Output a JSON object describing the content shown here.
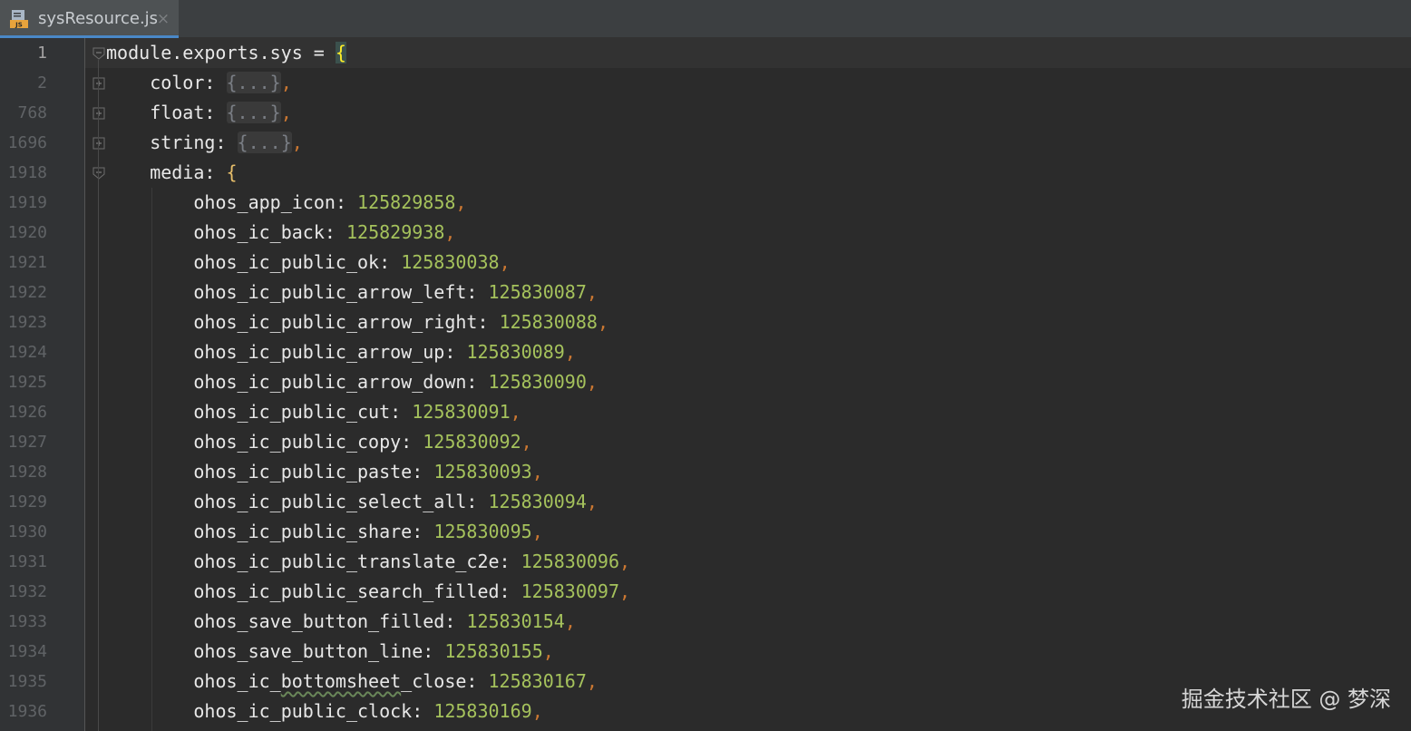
{
  "tab": {
    "title": "sysResource.js",
    "close_glyph": "×",
    "icon": "javascript-file-icon",
    "icon_badge": "JS"
  },
  "colors": {
    "background": "#2b2b2b",
    "gutter": "#313335",
    "keyword": "#e8e8e8",
    "number": "#a5c25c",
    "punctuation": "#cc7832",
    "brace": "#e8bf6a"
  },
  "lines": [
    {
      "no": "1",
      "indent": 0,
      "key": "module.exports.sys",
      "sep": " = ",
      "value": "{",
      "value_type": "brace-match",
      "trail": "",
      "fold": "open"
    },
    {
      "no": "2",
      "indent": 1,
      "key": "color",
      "sep": ": ",
      "value": "{...}",
      "value_type": "folded",
      "trail": ",",
      "fold": "plus"
    },
    {
      "no": "768",
      "indent": 1,
      "key": "float",
      "sep": ": ",
      "value": "{...}",
      "value_type": "folded",
      "trail": ",",
      "fold": "plus"
    },
    {
      "no": "1696",
      "indent": 1,
      "key": "string",
      "sep": ": ",
      "value": "{...}",
      "value_type": "folded",
      "trail": ",",
      "fold": "plus"
    },
    {
      "no": "1918",
      "indent": 1,
      "key": "media",
      "sep": ": ",
      "value": "{",
      "value_type": "brace",
      "trail": "",
      "fold": "open"
    },
    {
      "no": "1919",
      "indent": 2,
      "key": "ohos_app_icon",
      "sep": ": ",
      "value": "125829858",
      "value_type": "num",
      "trail": ","
    },
    {
      "no": "1920",
      "indent": 2,
      "key": "ohos_ic_back",
      "sep": ": ",
      "value": "125829938",
      "value_type": "num",
      "trail": ","
    },
    {
      "no": "1921",
      "indent": 2,
      "key": "ohos_ic_public_ok",
      "sep": ": ",
      "value": "125830038",
      "value_type": "num",
      "trail": ","
    },
    {
      "no": "1922",
      "indent": 2,
      "key": "ohos_ic_public_arrow_left",
      "sep": ": ",
      "value": "125830087",
      "value_type": "num",
      "trail": ","
    },
    {
      "no": "1923",
      "indent": 2,
      "key": "ohos_ic_public_arrow_right",
      "sep": ": ",
      "value": "125830088",
      "value_type": "num",
      "trail": ","
    },
    {
      "no": "1924",
      "indent": 2,
      "key": "ohos_ic_public_arrow_up",
      "sep": ": ",
      "value": "125830089",
      "value_type": "num",
      "trail": ","
    },
    {
      "no": "1925",
      "indent": 2,
      "key": "ohos_ic_public_arrow_down",
      "sep": ": ",
      "value": "125830090",
      "value_type": "num",
      "trail": ","
    },
    {
      "no": "1926",
      "indent": 2,
      "key": "ohos_ic_public_cut",
      "sep": ": ",
      "value": "125830091",
      "value_type": "num",
      "trail": ","
    },
    {
      "no": "1927",
      "indent": 2,
      "key": "ohos_ic_public_copy",
      "sep": ": ",
      "value": "125830092",
      "value_type": "num",
      "trail": ","
    },
    {
      "no": "1928",
      "indent": 2,
      "key": "ohos_ic_public_paste",
      "sep": ": ",
      "value": "125830093",
      "value_type": "num",
      "trail": ","
    },
    {
      "no": "1929",
      "indent": 2,
      "key": "ohos_ic_public_select_all",
      "sep": ": ",
      "value": "125830094",
      "value_type": "num",
      "trail": ","
    },
    {
      "no": "1930",
      "indent": 2,
      "key": "ohos_ic_public_share",
      "sep": ": ",
      "value": "125830095",
      "value_type": "num",
      "trail": ","
    },
    {
      "no": "1931",
      "indent": 2,
      "key": "ohos_ic_public_translate_c2e",
      "sep": ": ",
      "value": "125830096",
      "value_type": "num",
      "trail": ","
    },
    {
      "no": "1932",
      "indent": 2,
      "key": "ohos_ic_public_search_filled",
      "sep": ": ",
      "value": "125830097",
      "value_type": "num",
      "trail": ","
    },
    {
      "no": "1933",
      "indent": 2,
      "key": "ohos_save_button_filled",
      "sep": ": ",
      "value": "125830154",
      "value_type": "num",
      "trail": ","
    },
    {
      "no": "1934",
      "indent": 2,
      "key": "ohos_save_button_line",
      "sep": ": ",
      "value": "125830155",
      "value_type": "num",
      "trail": ","
    },
    {
      "no": "1935",
      "indent": 2,
      "key": "ohos_ic_bottomsheet_close",
      "sep": ": ",
      "value": "125830167",
      "value_type": "num",
      "trail": ",",
      "squiggle": "bottomsheet"
    },
    {
      "no": "1936",
      "indent": 2,
      "key": "ohos_ic_public_clock",
      "sep": ": ",
      "value": "125830169",
      "value_type": "num",
      "trail": ","
    }
  ],
  "watermark": "掘金技术社区 @ 梦深"
}
